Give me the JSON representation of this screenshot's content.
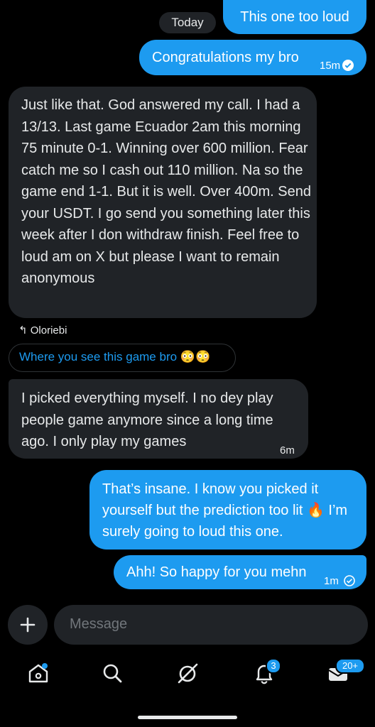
{
  "chat": {
    "date_label": "Today",
    "messages": [
      {
        "id": "m1",
        "text": "This one too loud"
      },
      {
        "id": "m2",
        "text": "Congratulations my bro",
        "time": "15m"
      },
      {
        "id": "m3",
        "text": "Just like that. God answered my call. I had a 13/13. Last game Ecuador 2am this morning 75 minute 0-1. Winning over 600 million. Fear catch me so I cash out 110 million. Na so the game end 1-1. But it is well. Over 400m. Send your USDT. I go send you something later this week after I don withdraw finish. Feel free to loud am on X but please I want to remain anonymous"
      },
      {
        "id": "m4",
        "reply_to": "Oloriebi",
        "quoted": "Where you see this game bro 😳😳",
        "text": "I picked everything myself. I no dey play people game anymore since a long time ago. I only play my games",
        "time": "6m"
      },
      {
        "id": "m5",
        "text": "That’s insane. I know you picked it yourself but the prediction too lit 🔥 I’m surely going to loud this one."
      },
      {
        "id": "m6",
        "text": "Ahh! So happy for you mehn",
        "time": "1m"
      }
    ]
  },
  "composer": {
    "placeholder": "Message",
    "add_icon": "plus-icon"
  },
  "nav": {
    "items": [
      {
        "name": "home",
        "icon": "home-icon"
      },
      {
        "name": "search",
        "icon": "search-icon"
      },
      {
        "name": "grok",
        "icon": "grok-icon"
      },
      {
        "name": "notifications",
        "icon": "bell-icon",
        "badge": "3"
      },
      {
        "name": "messages",
        "icon": "mail-icon",
        "badge": "20+"
      }
    ]
  },
  "colors": {
    "accent": "#1d9bf0",
    "incoming": "#202327",
    "background": "#000000"
  }
}
